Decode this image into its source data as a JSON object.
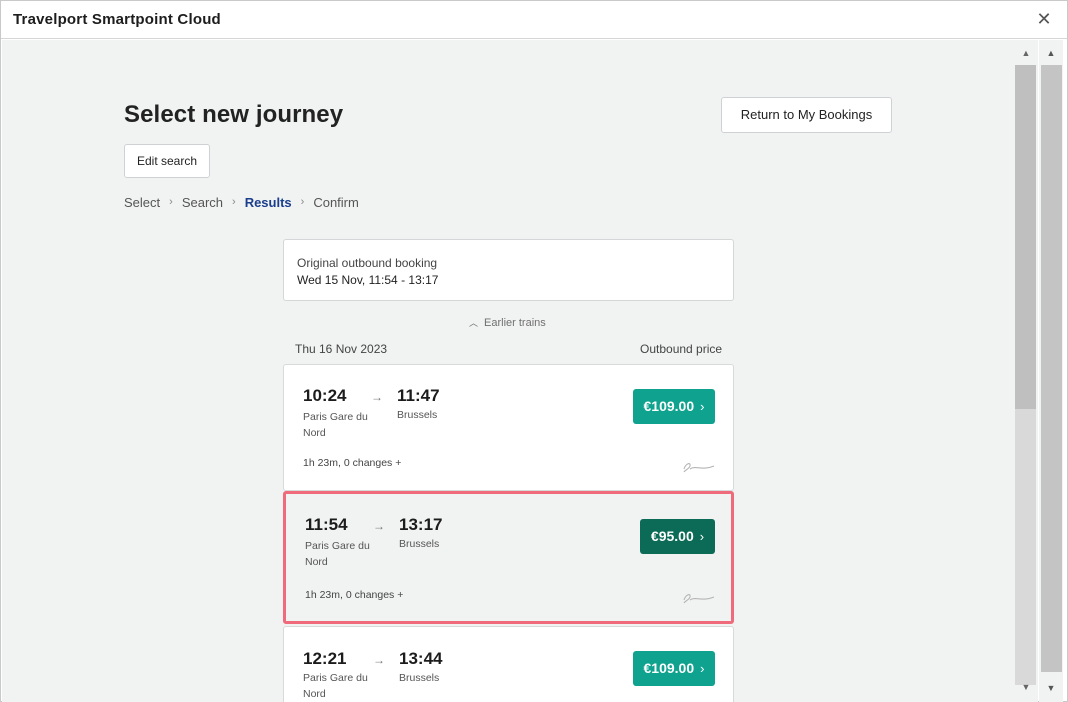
{
  "window": {
    "title": "Travelport Smartpoint Cloud",
    "close_glyph": "✕"
  },
  "page": {
    "title": "Select new journey",
    "return_label": "Return to My Bookings",
    "edit_label": "Edit search"
  },
  "steps": [
    {
      "label": "Select",
      "active": false
    },
    {
      "label": "Search",
      "active": false
    },
    {
      "label": "Results",
      "active": true
    },
    {
      "label": "Confirm",
      "active": false
    }
  ],
  "original_booking": {
    "label": "Original outbound booking",
    "details": "Wed 15 Nov, 11:54 - 13:17"
  },
  "earlier_trains_label": "Earlier trains",
  "date_label": "Thu 16 Nov 2023",
  "price_column_label": "Outbound price",
  "trains": [
    {
      "depart": "10:24",
      "arrive": "11:47",
      "from": "Paris Gare du Nord",
      "to": "Brussels",
      "duration": "1h 23m, 0 changes +",
      "price": "€109.00",
      "selected": false
    },
    {
      "depart": "11:54",
      "arrive": "13:17",
      "from": "Paris Gare du Nord",
      "to": "Brussels",
      "duration": "1h 23m, 0 changes +",
      "price": "€95.00",
      "selected": true
    },
    {
      "depart": "12:21",
      "arrive": "13:44",
      "from": "Paris Gare du Nord",
      "to": "Brussels",
      "duration": "1h 23m, 0 changes +",
      "price": "€109.00",
      "selected": false
    }
  ],
  "colors": {
    "price_button": "#0fa38f",
    "price_button_selected": "#0c6b56",
    "selected_border": "#ef6b7c",
    "active_step": "#1a3e8c"
  },
  "icons": {
    "close": "close-icon",
    "step_separator": "chevron-right-icon",
    "train_arrow": "arrow-right-icon",
    "caret_up": "chevron-up-icon",
    "operator_logo": "eurostar-logo"
  }
}
